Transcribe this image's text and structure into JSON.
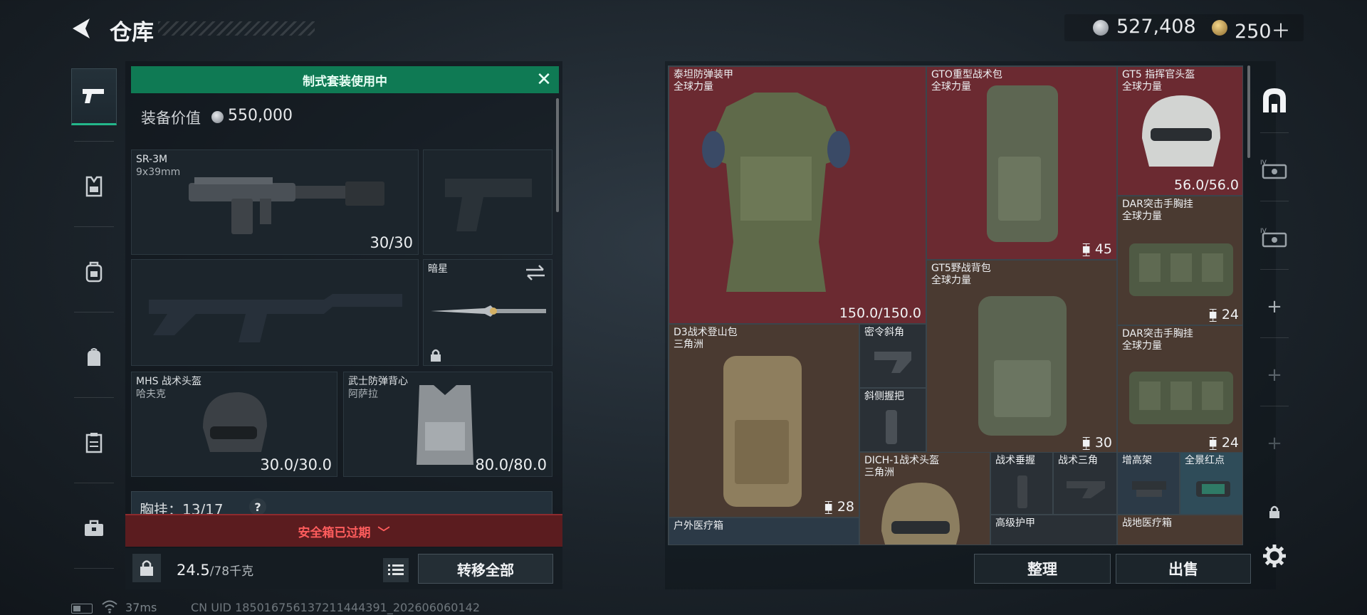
{
  "header": {
    "title": "仓库",
    "currency": {
      "silver": "527,408",
      "gold": "250"
    }
  },
  "tabs": [
    {
      "icon": "pistol-icon",
      "active": true
    },
    {
      "icon": "vest-icon",
      "active": false
    },
    {
      "icon": "backpack-icon",
      "active": false
    },
    {
      "icon": "pouch-icon",
      "active": false
    },
    {
      "icon": "container-icon",
      "active": false
    },
    {
      "icon": "toolbox-icon",
      "active": false
    }
  ],
  "loadout": {
    "banner": "制式套装使用中",
    "value_label": "装备价值",
    "value_amount": "550,000",
    "slots": {
      "primary": {
        "name": "SR-3M",
        "caliber": "9x39mm",
        "count": "30/30"
      },
      "melee": {
        "name": "暗星"
      },
      "helmet": {
        "name": "MHS 战术头盔",
        "sub": "哈夫克",
        "durability": "30.0/30.0"
      },
      "armor": {
        "name": "武士防弹背心",
        "sub": "阿萨拉",
        "durability": "80.0/80.0"
      }
    },
    "chest_rig": {
      "label": "胸挂：13/17",
      "help": "?"
    },
    "safebox": "安全箱已过期",
    "weight": {
      "current": "24.5",
      "max": "/78千克"
    },
    "transfer_label": "转移全部"
  },
  "stash": {
    "items": [
      {
        "name": "泰坦防弹装甲",
        "sub": "全球力量",
        "stat": "150.0/150.0"
      },
      {
        "name": "GTO重型战术包",
        "sub": "全球力量",
        "stat": "45"
      },
      {
        "name": "GT5 指挥官头盔",
        "sub": "全球力量",
        "stat": "56.0/56.0"
      },
      {
        "name": "DAR突击手胸挂",
        "sub": "全球力量",
        "stat": "24"
      },
      {
        "name": "GT5野战背包",
        "sub": "全球力量",
        "stat": "30"
      },
      {
        "name": "DAR突击手胸挂",
        "sub": "全球力量",
        "stat": "24"
      },
      {
        "name": "D3战术登山包",
        "sub": "三角洲",
        "stat": "28"
      },
      {
        "name": "密令斜角",
        "sub": "",
        "stat": ""
      },
      {
        "name": "斜侧握把",
        "sub": "",
        "stat": ""
      },
      {
        "name": "DICH-1战术头盔",
        "sub": "三角洲",
        "stat": ""
      },
      {
        "name": "战术垂握",
        "sub": "",
        "stat": ""
      },
      {
        "name": "战术三角",
        "sub": "",
        "stat": ""
      },
      {
        "name": "增高架",
        "sub": "",
        "stat": ""
      },
      {
        "name": "全景红点",
        "sub": "",
        "stat": ""
      },
      {
        "name": "户外医疗箱",
        "sub": "",
        "stat": ""
      },
      {
        "name": "高级护甲",
        "sub": "",
        "stat": ""
      },
      {
        "name": "战地医疗箱",
        "sub": "",
        "stat": ""
      }
    ],
    "sort_label": "整理",
    "sell_label": "出售"
  },
  "status": {
    "ping": "37ms",
    "uid": "CN UID 185016756137211444391_202606060142"
  },
  "colors": {
    "accent": "#0f7a54",
    "alert": "#ff5d5d",
    "cell_red": "#6b2a31",
    "cell_brown": "#4a3a31"
  }
}
